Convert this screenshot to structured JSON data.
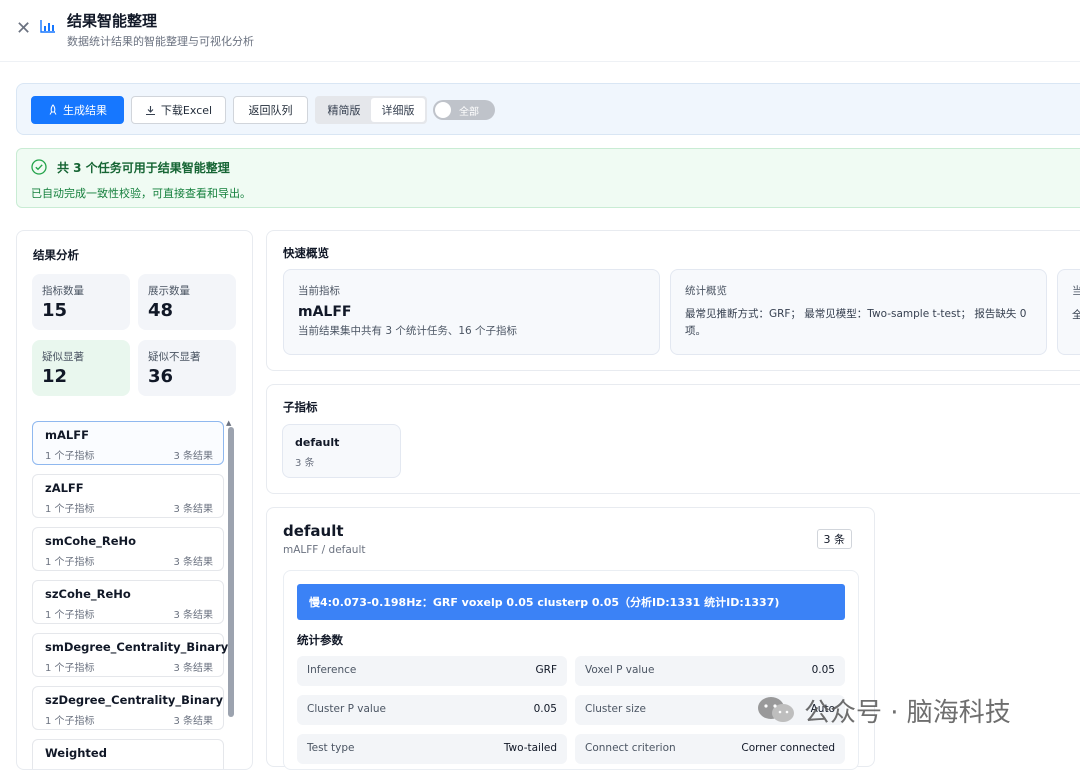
{
  "header": {
    "title": "结果智能整理",
    "subtitle": "数据统计结果的智能整理与可视化分析"
  },
  "toolbar": {
    "generate_label": "生成结果",
    "download_label": "下载Excel",
    "back_label": "返回队列",
    "mode_options": [
      "精简版",
      "详细版"
    ],
    "mode_selected": "详细版",
    "toggle_label": "全部"
  },
  "alert": {
    "title": "共 3 个任务可用于结果智能整理",
    "description": "已自动完成一致性校验，可直接查看和导出。"
  },
  "analysis": {
    "title": "结果分析",
    "stats": [
      {
        "label": "指标数量",
        "value": "15"
      },
      {
        "label": "展示数量",
        "value": "48"
      },
      {
        "label": "疑似显著",
        "value": "12"
      },
      {
        "label": "疑似不显著",
        "value": "36"
      }
    ],
    "metrics": [
      {
        "name": "mALFF",
        "sub": "1 个子指标",
        "count": "3 条结果"
      },
      {
        "name": "zALFF",
        "sub": "1 个子指标",
        "count": "3 条结果"
      },
      {
        "name": "smCohe_ReHo",
        "sub": "1 个子指标",
        "count": "3 条结果"
      },
      {
        "name": "szCohe_ReHo",
        "sub": "1 个子指标",
        "count": "3 条结果"
      },
      {
        "name": "smDegree_Centrality_Binary",
        "sub": "1 个子指标",
        "count": "3 条结果"
      },
      {
        "name": "szDegree_Centrality_Binary",
        "sub": "1 个子指标",
        "count": "3 条结果"
      },
      {
        "name": "Weighted",
        "sub": "",
        "count": ""
      }
    ]
  },
  "overview": {
    "title": "快速概览",
    "current": {
      "heading": "当前指标",
      "value": "mALFF",
      "desc": "当前结果集中共有 3 个统计任务、16 个子指标"
    },
    "stats": {
      "heading": "统计概览",
      "text": "最常见推断方式：GRF； 最常见模型：Two-sample t-test； 报告缺失 0 项。"
    },
    "third": {
      "heading": "当",
      "text": "全"
    }
  },
  "subindex": {
    "title": "子指标",
    "chip_name": "default",
    "chip_count": "3 条"
  },
  "detail": {
    "title": "default",
    "path": "mALFF / default",
    "badge": "3 条",
    "banner": "慢4:0.073-0.198Hz：GRF voxelp 0.05 clusterp 0.05（分析ID:1331 统计ID:1337)",
    "params_title": "统计参数",
    "params": [
      {
        "key": "Inference",
        "value": "GRF"
      },
      {
        "key": "Voxel P value",
        "value": "0.05"
      },
      {
        "key": "Cluster P value",
        "value": "0.05"
      },
      {
        "key": "Cluster size",
        "value": "Auto"
      },
      {
        "key": "Test type",
        "value": "Two-tailed"
      },
      {
        "key": "Connect criterion",
        "value": "Corner connected"
      }
    ]
  },
  "watermark": {
    "text": "公众号 · 脑海科技"
  },
  "colors": {
    "primary": "#1677ff",
    "banner": "#3b82f6",
    "success_bg": "#f0fbf3",
    "success_text": "#166534"
  }
}
